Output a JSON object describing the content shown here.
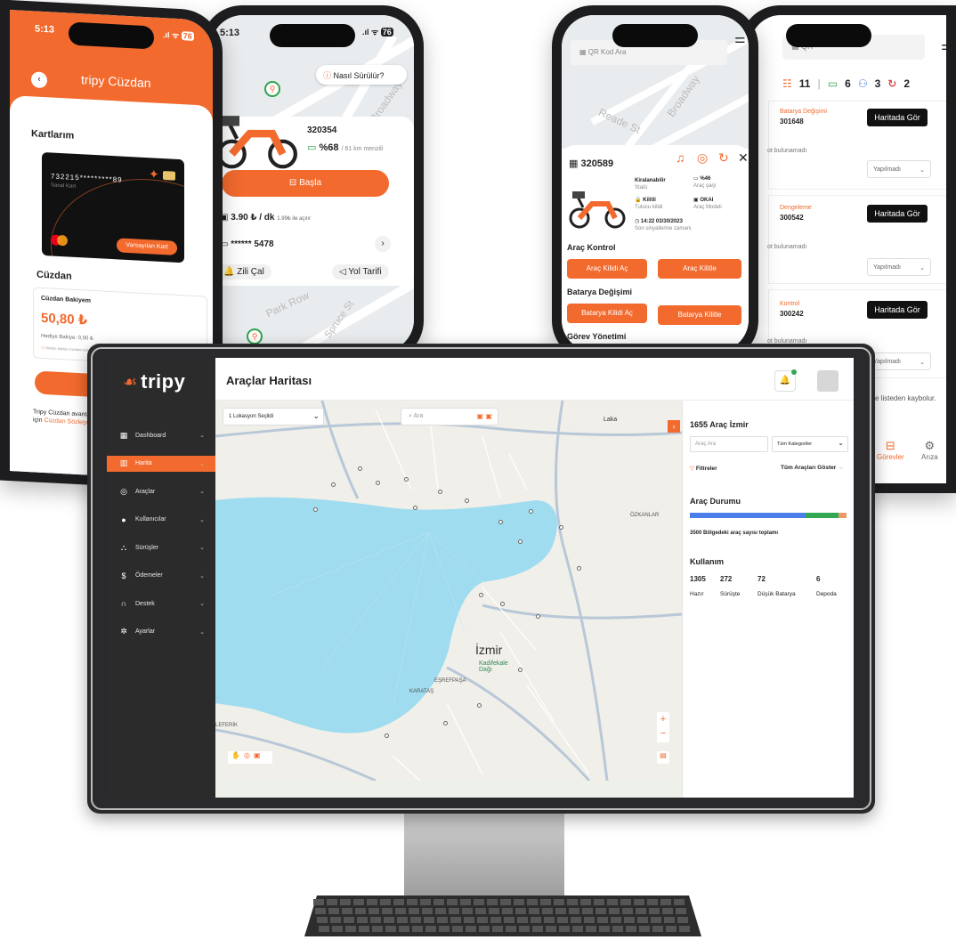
{
  "phone1": {
    "time": "5:13",
    "battery": "76",
    "title": "tripy Cüzdan",
    "cards_title": "Kartlarım",
    "card_number": "732215*********89",
    "card_label": "Sanal Kart",
    "card_default_button": "Varsayılan Kart",
    "wallet_title": "Cüzdan",
    "balance_label": "Cüzdan Bakiyem",
    "balance_value": "50,80 ₺",
    "gift_label": "Hediye Bakiye: 0,00 ₺",
    "notice": "Hediye bakiye cüzdanınızdaki bağlantı kuruluyor olabilir",
    "topup_button": "Bakiye Ekle",
    "footer_text": "Tripy Cüzdan avantajl",
    "footer_prefix": "için",
    "footer_link": "Cüzdan Sözleşm"
  },
  "phone2": {
    "time": "5:13",
    "battery": "76",
    "how_to_ride": "Nasıl Sürülür?",
    "street1": "Broadway",
    "street2": "Park Row",
    "street3": "Spruce St",
    "vehicle_id": "320354",
    "battery_pct": "%68",
    "range": "/ 61 km menzili",
    "start_button": "Başla",
    "price": "3.90 ₺ / dk",
    "unlock_fee": "1.99₺ ile açılır",
    "card_mask": "****** 5478",
    "ring_bell": "Zili Çal",
    "directions": "Yol Tarifi"
  },
  "phone3": {
    "search_placeholder": "QR Kod Ara",
    "street1": "Reade St",
    "street2": "Broadway",
    "vehicle_id": "320589",
    "rentable": "Kiralanabilir",
    "status_label": "Statü",
    "battery_pct": "%46",
    "battery_label": "Araç şarjı",
    "locked": "Kilitli",
    "lock_label": "Tutucu kilidi",
    "model": "OKAI",
    "model_label": "Araç Modeli",
    "last_update": "14:22 03/30/2023",
    "last_update_label": "Son sinyallerine zamanı",
    "section_vehicle": "Araç Kontrol",
    "unlock_vehicle": "Araç Kilidi Aç",
    "lock_vehicle": "Araç Kilitle",
    "section_battery": "Batarya Değişimi",
    "unlock_battery": "Batarya Kilidi Aç",
    "lock_battery": "Batarya Kilitle",
    "section_tasks": "Görev Yönetimi"
  },
  "phone4": {
    "search_placeholder": "QR",
    "count_tasks": "11",
    "count_battery": "6",
    "count_balance": "3",
    "count_control": "2",
    "tasks": [
      {
        "type": "Batarya Değişimi",
        "id": "301648",
        "note": "ot bulunamadı",
        "status": "Yapılmadı",
        "button": "Haritada Gör"
      },
      {
        "type": "Dengeleme",
        "id": "300542",
        "note": "ot bulunamadı",
        "status": "Yapılmadı",
        "button": "Haritada Gör"
      },
      {
        "type": "Kontrol",
        "id": "300242",
        "note": "ot bulunamadı",
        "status": "Yapılmadı",
        "button": "Haritada Gör"
      }
    ],
    "footer_note": "se listeden kaybolur.",
    "tab_tasks": "Görevler",
    "tab_fault": "Arıza"
  },
  "desktop": {
    "brand": "tripy",
    "page_title": "Araçlar Haritası",
    "nav": [
      {
        "label": "Dashboard",
        "icon": "grid-icon"
      },
      {
        "label": "Harita",
        "icon": "map-icon"
      },
      {
        "label": "Araçlar",
        "icon": "scooter-icon"
      },
      {
        "label": "Kullanıcılar",
        "icon": "user-icon"
      },
      {
        "label": "Sürüşler",
        "icon": "route-icon"
      },
      {
        "label": "Ödemeler",
        "icon": "payment-icon"
      },
      {
        "label": "Destek",
        "icon": "headset-icon"
      },
      {
        "label": "Ayarlar",
        "icon": "gear-icon"
      }
    ],
    "location_select": "1 Lokasyon Seçildi",
    "map_search_placeholder": "Ara",
    "map_labels": {
      "city": "İzmir",
      "kadifekale": "Kadifekale Dağı",
      "esrefpasa": "EŞREFPAŞA",
      "karatas": "KARATAŞ",
      "ozkanlar": "ÖZKANLAR",
      "laka": "Laka",
      "eferlik": "LEFERİK"
    },
    "panel": {
      "title": "1655 Araç İzmir",
      "search_placeholder": "Araç Ara",
      "category_select": "Tüm Kategoriler",
      "filters": "Filtreler",
      "show_all": "Tüm Araçları Göster",
      "status_title": "Araç Durumu",
      "status_caption": "3500 Bölgedeki araç sayısı toplamı",
      "usage_title": "Kullanım",
      "usage": [
        {
          "value": "1305",
          "label": "Hazır"
        },
        {
          "value": "272",
          "label": "Sürüşte"
        },
        {
          "value": "72",
          "label": "Düşük Batarya"
        },
        {
          "value": "6",
          "label": "Depoda"
        }
      ],
      "status_shares": [
        0.74,
        0.21,
        0.05
      ],
      "colors": {
        "ready": "#4a7ee8",
        "riding": "#33a852",
        "low": "#e99a6b"
      }
    }
  }
}
